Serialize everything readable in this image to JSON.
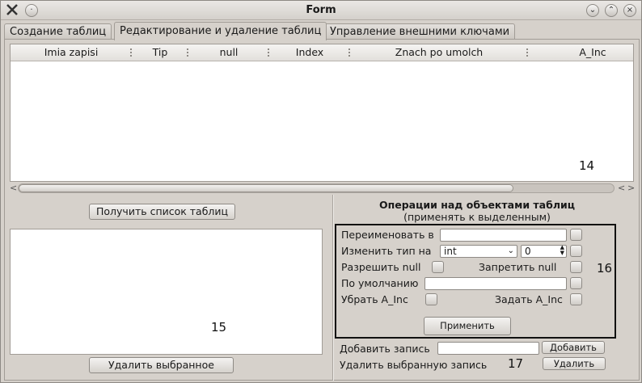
{
  "window": {
    "title": "Form"
  },
  "tabs": [
    {
      "label": "Создание таблиц"
    },
    {
      "label": "Редактирование и удаление таблиц"
    },
    {
      "label": "Управление внешними ключами"
    }
  ],
  "table": {
    "columns": [
      "Imia zapisi",
      "Tip",
      "null",
      "Index",
      "Znach po umolch",
      "A_Inc"
    ]
  },
  "annotations": {
    "table": "14",
    "listbox": "15",
    "ops": "16",
    "records": "17"
  },
  "left": {
    "get_tables_button": "Получить список таблиц",
    "delete_selected_button": "Удалить выбранное"
  },
  "ops": {
    "heading": "Операции над объектами таблиц",
    "subheading": "(применять к выделенным)",
    "rename_label": "Переименовать в",
    "rename_value": "",
    "change_type_label": "Изменить тип на",
    "type_selected": "int",
    "size_value": "0",
    "allow_null_label": "Разрешить null",
    "forbid_null_label": "Запретить null",
    "default_label": "По умолчанию",
    "default_value": "",
    "remove_ainc_label": "Убрать A_Inc",
    "set_ainc_label": "Задать A_Inc",
    "apply_button": "Применить"
  },
  "records": {
    "add_label": "Добавить запись",
    "add_value": "",
    "add_button": "Добавить",
    "delete_label": "Удалить выбранную запись",
    "delete_button": "Удалить"
  }
}
